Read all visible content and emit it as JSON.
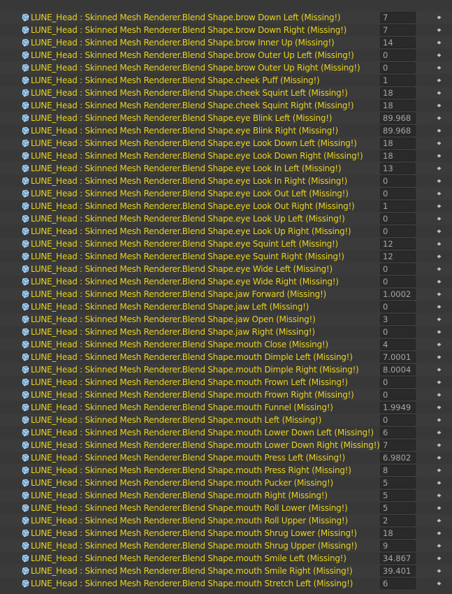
{
  "rows": [
    {
      "label": "LUNE_Head : Skinned Mesh Renderer.Blend Shape.brow Down Left (Missing!)",
      "value": "7"
    },
    {
      "label": "LUNE_Head : Skinned Mesh Renderer.Blend Shape.brow Down Right (Missing!)",
      "value": "7"
    },
    {
      "label": "LUNE_Head : Skinned Mesh Renderer.Blend Shape.brow Inner Up (Missing!)",
      "value": "14"
    },
    {
      "label": "LUNE_Head : Skinned Mesh Renderer.Blend Shape.brow Outer Up Left (Missing!)",
      "value": "0"
    },
    {
      "label": "LUNE_Head : Skinned Mesh Renderer.Blend Shape.brow Outer Up Right (Missing!)",
      "value": "0"
    },
    {
      "label": "LUNE_Head : Skinned Mesh Renderer.Blend Shape.cheek Puff (Missing!)",
      "value": "1"
    },
    {
      "label": "LUNE_Head : Skinned Mesh Renderer.Blend Shape.cheek Squint Left (Missing!)",
      "value": "18"
    },
    {
      "label": "LUNE_Head : Skinned Mesh Renderer.Blend Shape.cheek Squint Right (Missing!)",
      "value": "18"
    },
    {
      "label": "LUNE_Head : Skinned Mesh Renderer.Blend Shape.eye Blink Left (Missing!)",
      "value": "89.968"
    },
    {
      "label": "LUNE_Head : Skinned Mesh Renderer.Blend Shape.eye Blink Right (Missing!)",
      "value": "89.968"
    },
    {
      "label": "LUNE_Head : Skinned Mesh Renderer.Blend Shape.eye Look Down Left (Missing!)",
      "value": "18"
    },
    {
      "label": "LUNE_Head : Skinned Mesh Renderer.Blend Shape.eye Look Down Right (Missing!)",
      "value": "18"
    },
    {
      "label": "LUNE_Head : Skinned Mesh Renderer.Blend Shape.eye Look In Left (Missing!)",
      "value": "13"
    },
    {
      "label": "LUNE_Head : Skinned Mesh Renderer.Blend Shape.eye Look In Right (Missing!)",
      "value": "0"
    },
    {
      "label": "LUNE_Head : Skinned Mesh Renderer.Blend Shape.eye Look Out Left (Missing!)",
      "value": "0"
    },
    {
      "label": "LUNE_Head : Skinned Mesh Renderer.Blend Shape.eye Look Out Right (Missing!)",
      "value": "1"
    },
    {
      "label": "LUNE_Head : Skinned Mesh Renderer.Blend Shape.eye Look Up Left (Missing!)",
      "value": "0"
    },
    {
      "label": "LUNE_Head : Skinned Mesh Renderer.Blend Shape.eye Look Up Right (Missing!)",
      "value": "0"
    },
    {
      "label": "LUNE_Head : Skinned Mesh Renderer.Blend Shape.eye Squint Left (Missing!)",
      "value": "12"
    },
    {
      "label": "LUNE_Head : Skinned Mesh Renderer.Blend Shape.eye Squint Right (Missing!)",
      "value": "12"
    },
    {
      "label": "LUNE_Head : Skinned Mesh Renderer.Blend Shape.eye Wide Left (Missing!)",
      "value": "0"
    },
    {
      "label": "LUNE_Head : Skinned Mesh Renderer.Blend Shape.eye Wide Right (Missing!)",
      "value": "0"
    },
    {
      "label": "LUNE_Head : Skinned Mesh Renderer.Blend Shape.jaw Forward (Missing!)",
      "value": "1.0002"
    },
    {
      "label": "LUNE_Head : Skinned Mesh Renderer.Blend Shape.jaw Left (Missing!)",
      "value": "0"
    },
    {
      "label": "LUNE_Head : Skinned Mesh Renderer.Blend Shape.jaw Open (Missing!)",
      "value": "3"
    },
    {
      "label": "LUNE_Head : Skinned Mesh Renderer.Blend Shape.jaw Right (Missing!)",
      "value": "0"
    },
    {
      "label": "LUNE_Head : Skinned Mesh Renderer.Blend Shape.mouth Close (Missing!)",
      "value": "4"
    },
    {
      "label": "LUNE_Head : Skinned Mesh Renderer.Blend Shape.mouth Dimple Left (Missing!)",
      "value": "7.0001"
    },
    {
      "label": "LUNE_Head : Skinned Mesh Renderer.Blend Shape.mouth Dimple Right (Missing!)",
      "value": "8.0004"
    },
    {
      "label": "LUNE_Head : Skinned Mesh Renderer.Blend Shape.mouth Frown Left (Missing!)",
      "value": "0"
    },
    {
      "label": "LUNE_Head : Skinned Mesh Renderer.Blend Shape.mouth Frown Right (Missing!)",
      "value": "0"
    },
    {
      "label": "LUNE_Head : Skinned Mesh Renderer.Blend Shape.mouth Funnel (Missing!)",
      "value": "1.9949"
    },
    {
      "label": "LUNE_Head : Skinned Mesh Renderer.Blend Shape.mouth Left (Missing!)",
      "value": "0"
    },
    {
      "label": "LUNE_Head : Skinned Mesh Renderer.Blend Shape.mouth Lower Down Left (Missing!)",
      "value": "6"
    },
    {
      "label": "LUNE_Head : Skinned Mesh Renderer.Blend Shape.mouth Lower Down Right (Missing!)",
      "value": "7"
    },
    {
      "label": "LUNE_Head : Skinned Mesh Renderer.Blend Shape.mouth Press Left (Missing!)",
      "value": "6.9802"
    },
    {
      "label": "LUNE_Head : Skinned Mesh Renderer.Blend Shape.mouth Press Right (Missing!)",
      "value": "8"
    },
    {
      "label": "LUNE_Head : Skinned Mesh Renderer.Blend Shape.mouth Pucker (Missing!)",
      "value": "5"
    },
    {
      "label": "LUNE_Head : Skinned Mesh Renderer.Blend Shape.mouth Right (Missing!)",
      "value": "5"
    },
    {
      "label": "LUNE_Head : Skinned Mesh Renderer.Blend Shape.mouth Roll Lower (Missing!)",
      "value": "5"
    },
    {
      "label": "LUNE_Head : Skinned Mesh Renderer.Blend Shape.mouth Roll Upper (Missing!)",
      "value": "2"
    },
    {
      "label": "LUNE_Head : Skinned Mesh Renderer.Blend Shape.mouth Shrug Lower (Missing!)",
      "value": "18"
    },
    {
      "label": "LUNE_Head : Skinned Mesh Renderer.Blend Shape.mouth Shrug Upper (Missing!)",
      "value": "9"
    },
    {
      "label": "LUNE_Head : Skinned Mesh Renderer.Blend Shape.mouth Smile Left (Missing!)",
      "value": "34.867"
    },
    {
      "label": "LUNE_Head : Skinned Mesh Renderer.Blend Shape.mouth Smile Right (Missing!)",
      "value": "39.401"
    },
    {
      "label": "LUNE_Head : Skinned Mesh Renderer.Blend Shape.mouth Stretch Left (Missing!)",
      "value": "6"
    }
  ],
  "icons": {
    "row_icon": "skinned-mesh-renderer-icon",
    "row_menu": "keyframe-options-icon"
  },
  "colors": {
    "missing_text": "#e8d21f",
    "background": "#383838"
  }
}
